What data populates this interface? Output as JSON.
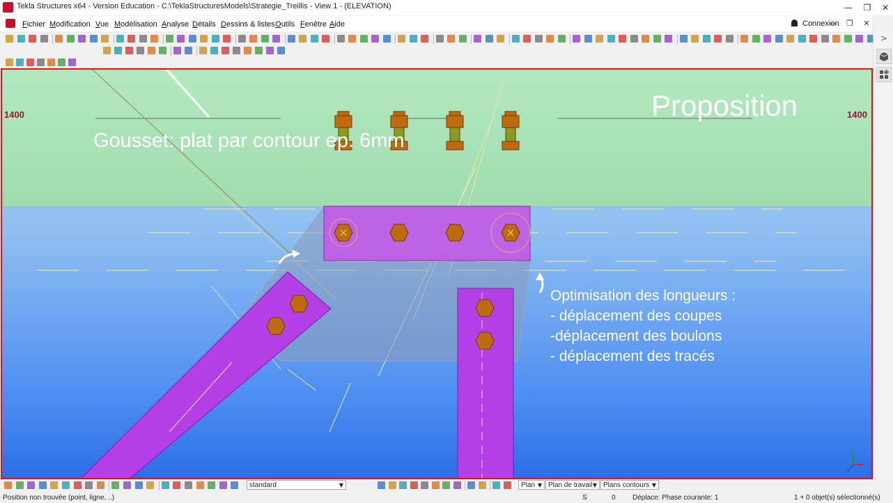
{
  "window": {
    "title": "Tekla Structures x64 - Version Education - C:\\TeklaStructuresModels\\Strategie_Treillis  - View 1 - (ELEVATION)",
    "minimize": "—",
    "maximize": "❐",
    "close": "✕"
  },
  "menu": {
    "items": [
      "Fichier",
      "Modification",
      "Vue",
      "Modélisation",
      "Analyse",
      "Détails",
      "Dessins & listes",
      "Outils",
      "Fenêtre",
      "Aide"
    ],
    "user_label": "Connexion",
    "min": "—",
    "restore": "❐",
    "close": "✕"
  },
  "viewport": {
    "level_left": "1400",
    "level_right": "1400",
    "heading": "Proposition",
    "callout_gousset": "Gousset: plat par contour ep. 6mm",
    "callout_optim": [
      "Optimisation des longueurs :",
      "- déplacement des coupes",
      "-déplacement des boulons",
      "- déplacement des tracés"
    ],
    "colors": {
      "frame": "#e8111a",
      "member": "#b033e0",
      "plate": "#c356e0",
      "bolt": "#b8600a",
      "level_text": "#8b1a32"
    }
  },
  "right_panel": {
    "arrow": ">"
  },
  "statusbar": {
    "standard_value": "standard",
    "plan_label": "Plan",
    "plan_travail_label": "Plan de travail",
    "plans_contours_label": "Plans contours",
    "message": "Position non trouvée (point, ligne, ..)",
    "s_label": "S",
    "zero_label": "0",
    "mode_text": "Déplace: Phase courante: 1",
    "selection_text": "1 + 0 objet(s) sélectionné(s)"
  },
  "icons": [
    "app-icon",
    "user-icon",
    "chevron-right-icon",
    "cube-icon",
    "grid-add-icon",
    "axis-icon",
    "dropdown-arrow-icon"
  ]
}
